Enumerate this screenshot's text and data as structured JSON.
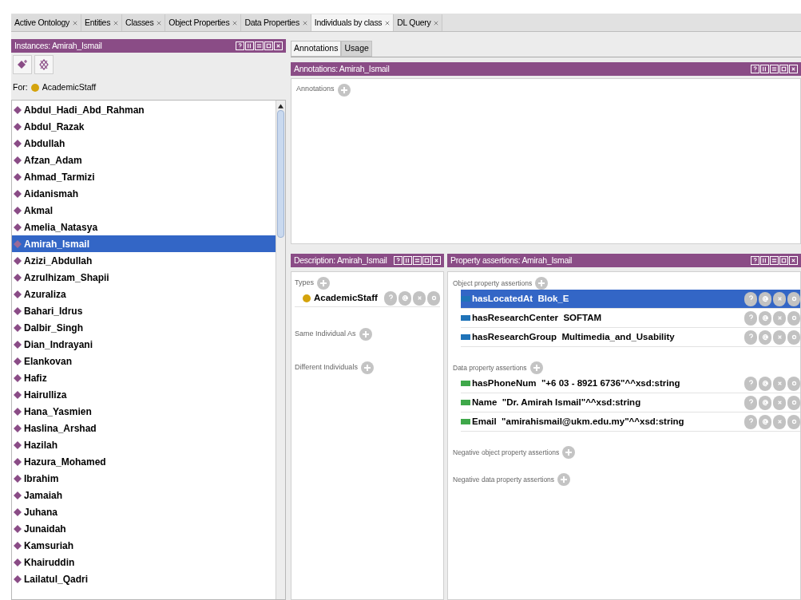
{
  "tabs": [
    {
      "label": "Active Ontology",
      "selected": false
    },
    {
      "label": "Entities",
      "selected": false
    },
    {
      "label": "Classes",
      "selected": false
    },
    {
      "label": "Object Properties",
      "selected": false
    },
    {
      "label": "Data Properties",
      "selected": false
    },
    {
      "label": "Individuals by class",
      "selected": true
    },
    {
      "label": "DL Query",
      "selected": false
    }
  ],
  "instances_panel": {
    "title": "Instances: Amirah_Ismail",
    "for_label": "For:",
    "for_class": "AcademicStaff",
    "individuals": [
      {
        "name": "Abdul_Hadi_Abd_Rahman",
        "selected": false
      },
      {
        "name": "Abdul_Razak",
        "selected": false
      },
      {
        "name": "Abdullah",
        "selected": false
      },
      {
        "name": "Afzan_Adam",
        "selected": false
      },
      {
        "name": "Ahmad_Tarmizi",
        "selected": false
      },
      {
        "name": "Aidanismah",
        "selected": false
      },
      {
        "name": "Akmal",
        "selected": false
      },
      {
        "name": "Amelia_Natasya",
        "selected": false
      },
      {
        "name": "Amirah_Ismail",
        "selected": true
      },
      {
        "name": "Azizi_Abdullah",
        "selected": false
      },
      {
        "name": "Azrulhizam_Shapii",
        "selected": false
      },
      {
        "name": "Azuraliza",
        "selected": false
      },
      {
        "name": "Bahari_Idrus",
        "selected": false
      },
      {
        "name": "Dalbir_Singh",
        "selected": false
      },
      {
        "name": "Dian_Indrayani",
        "selected": false
      },
      {
        "name": "Elankovan",
        "selected": false
      },
      {
        "name": "Hafiz",
        "selected": false
      },
      {
        "name": "Hairulliza",
        "selected": false
      },
      {
        "name": "Hana_Yasmien",
        "selected": false
      },
      {
        "name": "Haslina_Arshad",
        "selected": false
      },
      {
        "name": "Hazilah",
        "selected": false
      },
      {
        "name": "Hazura_Mohamed",
        "selected": false
      },
      {
        "name": "Ibrahim",
        "selected": false
      },
      {
        "name": "Jamaiah",
        "selected": false
      },
      {
        "name": "Juhana",
        "selected": false
      },
      {
        "name": "Junaidah",
        "selected": false
      },
      {
        "name": "Kamsuriah",
        "selected": false
      },
      {
        "name": "Khairuddin",
        "selected": false
      },
      {
        "name": "Lailatul_Qadri",
        "selected": false
      }
    ]
  },
  "view_tabs": [
    {
      "label": "Annotations",
      "selected": true
    },
    {
      "label": "Usage",
      "selected": false
    }
  ],
  "annotations_panel": {
    "title": "Annotations: Amirah_Ismail",
    "section": "Annotations"
  },
  "description_panel": {
    "title": "Description: Amirah_Ismail",
    "sections": [
      {
        "label": "Types",
        "items": [
          "AcademicStaff"
        ]
      },
      {
        "label": "Same Individual As"
      },
      {
        "label": "Different Individuals"
      }
    ]
  },
  "property_panel": {
    "title": "Property assertions: Amirah_Ismail",
    "sections": [
      {
        "label": "Object property assertions",
        "rows": [
          {
            "kind": "object",
            "property": "hasLocatedAt",
            "value": "Blok_E",
            "selected": true
          },
          {
            "kind": "object",
            "property": "hasResearchCenter",
            "value": "SOFTAM",
            "selected": false
          },
          {
            "kind": "object",
            "property": "hasResearchGroup",
            "value": "Multimedia_and_Usability",
            "selected": false
          }
        ]
      },
      {
        "label": "Data property assertions",
        "rows": [
          {
            "kind": "data",
            "property": "hasPhoneNum",
            "value": "\"+6 03 - 8921 6736\"^^xsd:string",
            "selected": false
          },
          {
            "kind": "data",
            "property": "Name",
            "value": "\"Dr. Amirah Ismail\"^^xsd:string",
            "selected": false
          },
          {
            "kind": "data",
            "property": "Email",
            "value": "\"amirahismail@ukm.edu.my\"^^xsd:string",
            "selected": false
          }
        ]
      },
      {
        "label": "Negative object property assertions"
      },
      {
        "label": "Negative data property assertions"
      }
    ]
  }
}
